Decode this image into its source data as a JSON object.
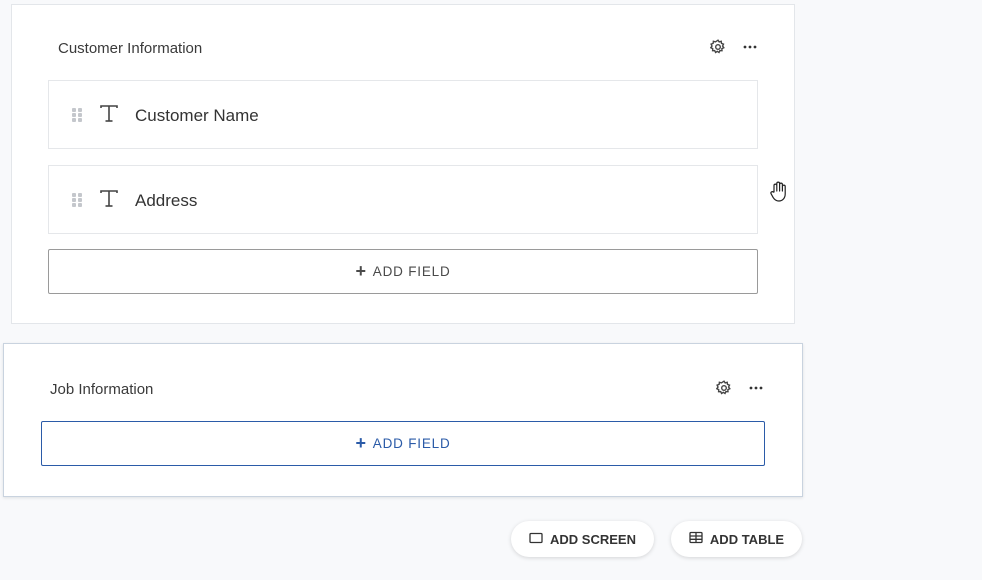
{
  "sections": [
    {
      "title": "Customer Information",
      "fields": [
        {
          "label": "Customer Name",
          "type_icon": "text-type-icon"
        },
        {
          "label": "Address",
          "type_icon": "text-type-icon"
        }
      ],
      "add_field_label": "ADD FIELD"
    },
    {
      "title": "Job Information",
      "fields": [],
      "add_field_label": "ADD FIELD"
    }
  ],
  "footer": {
    "add_screen_label": "ADD SCREEN",
    "add_table_label": "ADD TABLE"
  },
  "icons": {
    "settings": "gear-icon",
    "more": "more-horizontal-icon",
    "drag": "drag-handle-icon",
    "cursor": "hand-cursor-icon"
  },
  "colors": {
    "accent": "#2b5ba8",
    "background": "#f8f9fb",
    "card": "#ffffff"
  }
}
